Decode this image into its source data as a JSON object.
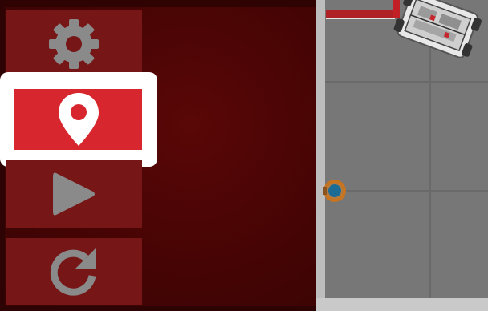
{
  "toolbar": {
    "buttons": [
      {
        "id": "settings",
        "icon": "gear-icon",
        "active": false
      },
      {
        "id": "location",
        "icon": "map-pin-icon",
        "active": true
      },
      {
        "id": "play",
        "icon": "play-icon",
        "active": false
      },
      {
        "id": "reset",
        "icon": "refresh-icon",
        "active": false
      }
    ]
  },
  "colors": {
    "panel_background": "#460404",
    "button_background": "#761616",
    "active_button": "#d7262e",
    "active_frame": "#ffffff",
    "icon": "#8a8a8a",
    "field_mat": "#777777",
    "field_wall": "#d4d4d4",
    "target_ring": "#c8741e",
    "target_center": "#1c6c95"
  },
  "field": {
    "robot": "robot-top-view",
    "marker": "target-marker"
  }
}
